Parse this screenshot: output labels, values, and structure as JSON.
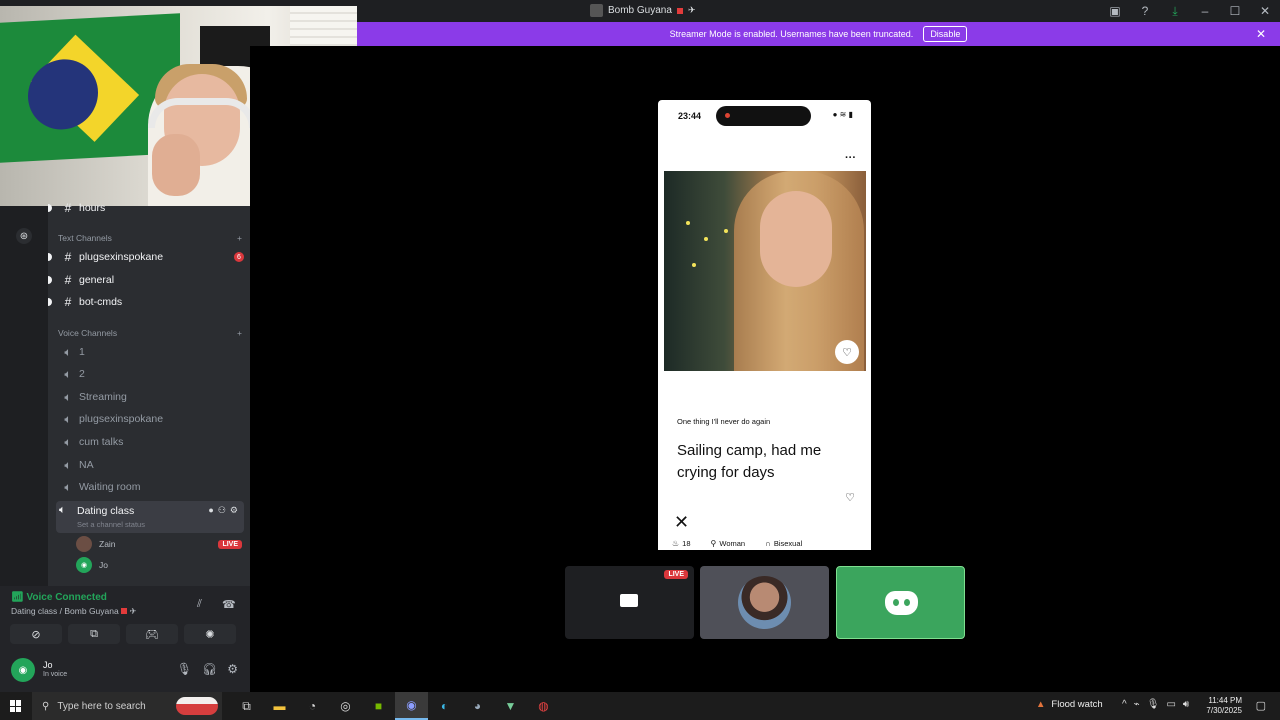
{
  "window": {
    "title": "Bomb Guyana",
    "controls": [
      "inbox-icon",
      "help-icon",
      "download-icon",
      "minimize",
      "maximize",
      "close"
    ]
  },
  "streamer_banner": {
    "message": "Streamer Mode is enabled. Usernames have been truncated.",
    "button_label": "Disable"
  },
  "channels": {
    "partial_top": "hours",
    "text_category": "Text Channels",
    "text": [
      {
        "name": "plugsexinspokane",
        "badge": "6"
      },
      {
        "name": "general"
      },
      {
        "name": "bot-cmds"
      }
    ],
    "voice_category": "Voice Channels",
    "voice": [
      "1",
      "2",
      "Streaming",
      "plugsexinspokane",
      "cum talks",
      "NA",
      "Waiting room"
    ],
    "active_voice": {
      "name": "Dating class",
      "status_placeholder": "Set a channel status",
      "members": [
        {
          "name": "Zain",
          "live": "LIVE"
        },
        {
          "name": "Jo"
        }
      ]
    }
  },
  "voice_panel": {
    "title": "Voice Connected",
    "subtitle": "Dating class / Bomb Guyana"
  },
  "user_panel": {
    "name": "Jo",
    "status": "In voice"
  },
  "stream": {
    "phone_time": "23:44",
    "prompt_question": "One thing I'll never do again",
    "prompt_answer": "Sailing camp, had me crying for days",
    "info": [
      {
        "icon": "cake-icon",
        "text": "18"
      },
      {
        "icon": "person-icon",
        "text": "Woman"
      },
      {
        "icon": "magnet-icon",
        "text": "Bisexual"
      }
    ]
  },
  "tiles": {
    "live_badge": "LIVE"
  },
  "taskbar": {
    "search_placeholder": "Type here to search",
    "weather": "Flood watch",
    "time": "11:44 PM",
    "date": "7/30/2025"
  }
}
